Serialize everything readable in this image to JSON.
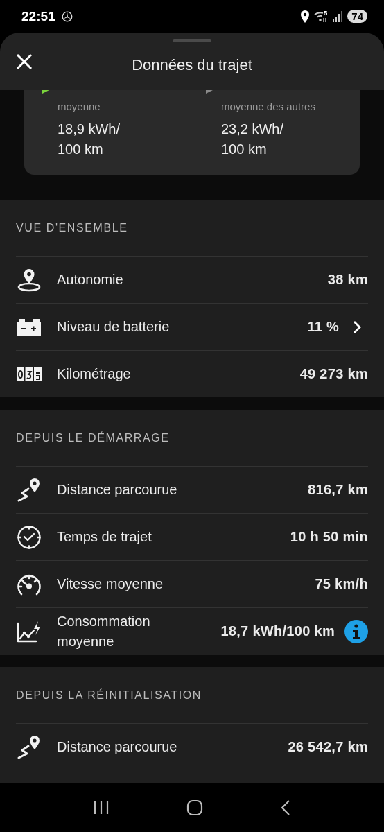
{
  "status_bar": {
    "time": "22:51",
    "wifi_band": "5",
    "battery": "74"
  },
  "sheet": {
    "title": "Données du trajet"
  },
  "comparison": [
    {
      "color": "#7bd23c",
      "label": "moyenne",
      "value_lines": [
        "18,9 kWh/",
        "100 km"
      ]
    },
    {
      "color": "#8a8a8a",
      "label": "moyenne des autres",
      "value_lines": [
        "23,2 kWh/",
        "100 km"
      ]
    }
  ],
  "sections": [
    {
      "title": "VUE D'ENSEMBLE",
      "rows": [
        {
          "kind": "plain",
          "label": "Autonomie",
          "value": "38 km"
        },
        {
          "kind": "link",
          "label": "Niveau de batterie",
          "value": "11 %"
        },
        {
          "kind": "plain",
          "label": "Kilométrage",
          "value": "49 273 km"
        }
      ]
    },
    {
      "title": "DEPUIS LE DÉMARRAGE",
      "rows": [
        {
          "kind": "plain",
          "label": "Distance parcourue",
          "value": "816,7 km"
        },
        {
          "kind": "plain",
          "label": "Temps de trajet",
          "value": "10 h 50 min"
        },
        {
          "kind": "plain",
          "label": "Vitesse moyenne",
          "value": "75 km/h"
        },
        {
          "kind": "info",
          "label": "Consommation moyenne",
          "value": "18,7 kWh/100 km"
        }
      ]
    },
    {
      "title": "DEPUIS LA RÉINITIALISATION",
      "rows": [
        {
          "kind": "plain",
          "label": "Distance parcourue",
          "value": "26 542,7 km"
        }
      ]
    }
  ]
}
